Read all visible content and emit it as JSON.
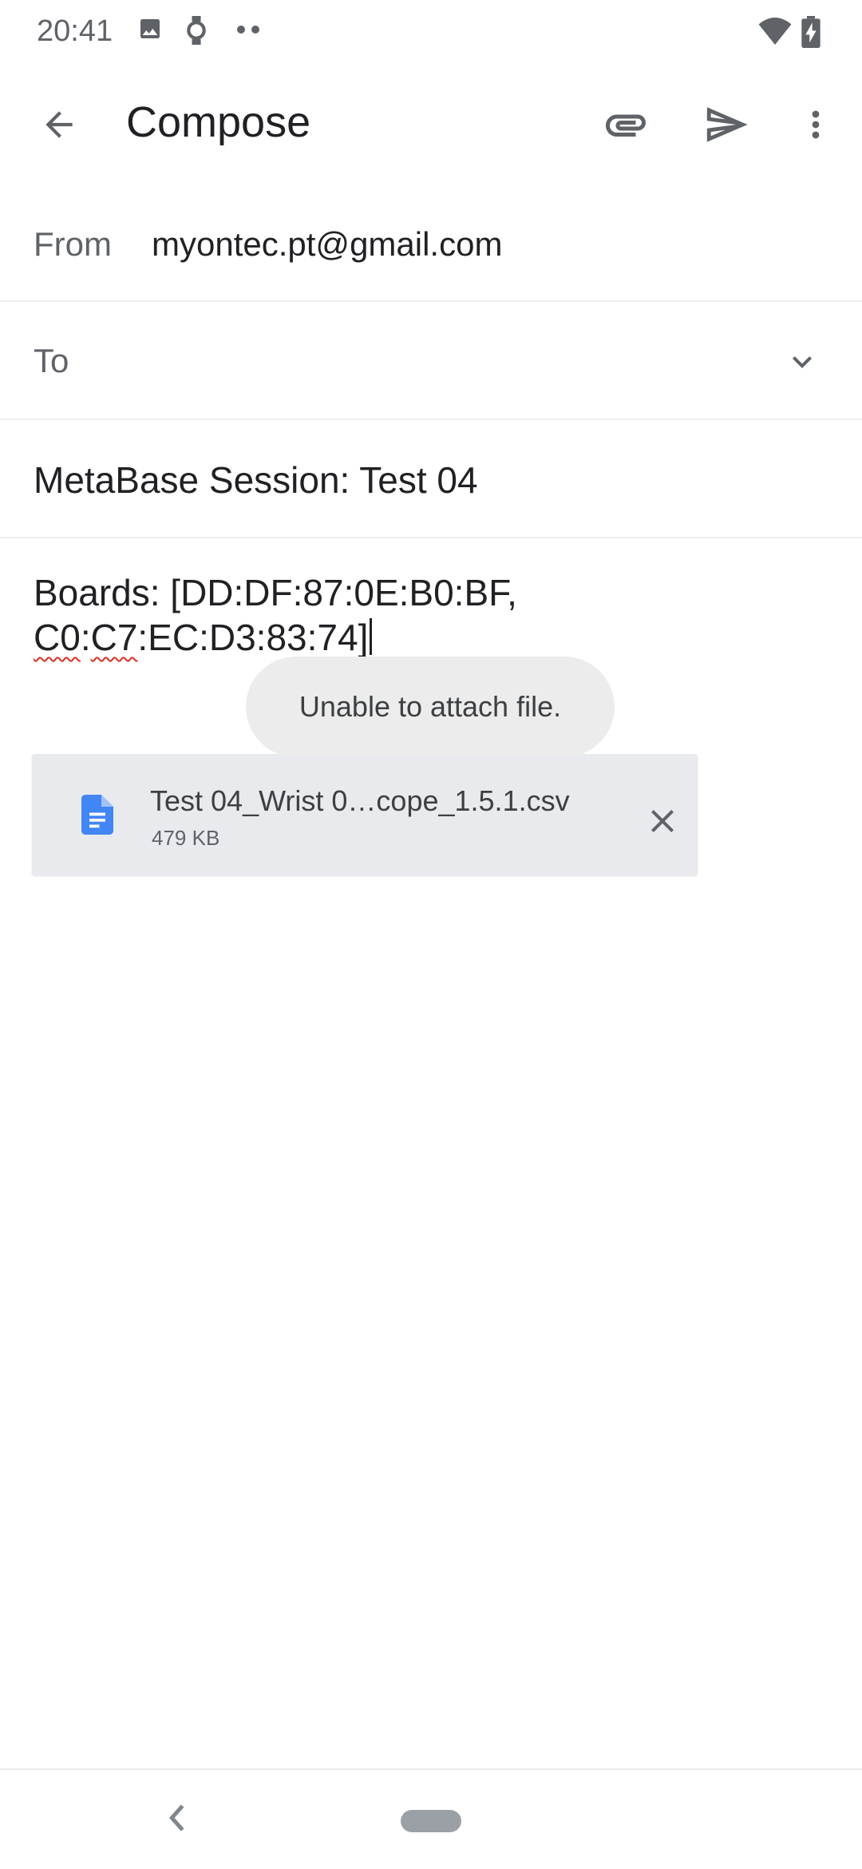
{
  "status_bar": {
    "time": "20:41",
    "icons_left": [
      "image-icon",
      "watch-icon",
      "more-dots-icon"
    ],
    "icons_right": [
      "wifi-icon",
      "battery-charging-icon"
    ]
  },
  "toolbar": {
    "title": "Compose",
    "back_icon": "arrow-back-icon",
    "attach_icon": "paperclip-icon",
    "send_icon": "send-icon",
    "overflow_icon": "more-vert-icon"
  },
  "compose": {
    "from_label": "From",
    "from_value": "myontec.pt@gmail.com",
    "to_label": "To",
    "subject": "MetaBase Session: Test 04",
    "body_line1": "Boards: [DD:DF:87:0E:B0:BF,",
    "body_line2_a": "C0",
    "body_line2_b": ":",
    "body_line2_c": "C7",
    "body_line2_d": ":EC:D3:83:74]"
  },
  "toast": {
    "message": "Unable to attach file."
  },
  "attachment": {
    "name": "Test 04_Wrist 0…cope_1.5.1.csv",
    "size": "479 KB",
    "icon": "document-icon"
  },
  "colors": {
    "doc_icon": "#4285f4",
    "icon_gray": "#5f6368",
    "toast_bg": "#ececec",
    "chip_bg": "#e8eaed",
    "spellcheck": "#d93025"
  }
}
